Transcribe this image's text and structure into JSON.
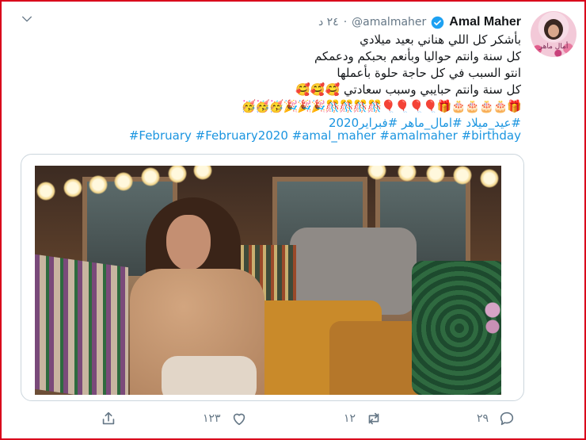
{
  "tweet": {
    "author_name": "Amal Maher",
    "handle": "@amalmaher",
    "separator": "·",
    "time": "٢٤ د",
    "avatar": {
      "logo_text": "أمال ماهر"
    },
    "lines": [
      "بأشكر كل اللي هناني بعيد ميلادي",
      "كل سنة وانتم حواليا وبأنعم بحبكم ودعمكم",
      "انتو السبب في كل حاجة حلوة بأعملها",
      "كل سنة وانتم حبايبي وسبب سعادتي"
    ],
    "emoji_line_1": "🥰🥰🥰",
    "emoji_line_2": "🎁🎂🎂🎂🎂🎁🎈🎈🎈🎈🎊🎊🎊🎊🎉🎉🎉🥳🥳🥳",
    "hashtags_ar": [
      "#عيد_ميلاد",
      "#امال_ماهر",
      "#فبراير2020"
    ],
    "hashtags_en": [
      "#February",
      "#February2020",
      "#amal_maher",
      "#amalmaher",
      "#birthday"
    ]
  },
  "actions": {
    "reply_count": "٢٩",
    "retweet_count": "١٢",
    "like_count": "١٢٣"
  },
  "colors": {
    "link": "#1b95e0",
    "muted": "#657786",
    "verified": "#1da1f2",
    "frame_border": "#d9001b"
  }
}
